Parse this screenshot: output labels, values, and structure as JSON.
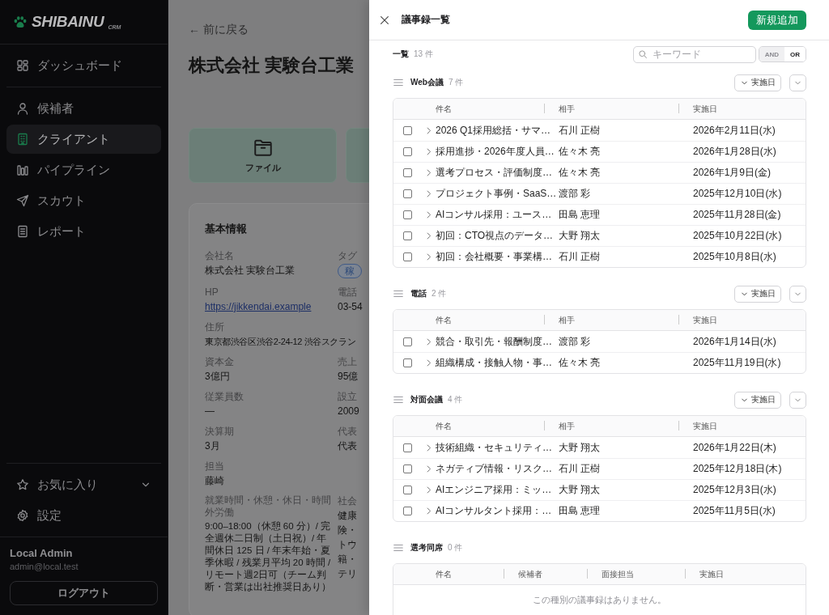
{
  "sidebar": {
    "logo": {
      "name": "SHIBAINU",
      "suffix": "CRM"
    },
    "nav_top": [
      {
        "label": "ダッシュボード",
        "selected": false
      }
    ],
    "nav": [
      {
        "label": "候補者",
        "selected": false
      },
      {
        "label": "クライアント",
        "selected": true
      },
      {
        "label": "パイプライン",
        "selected": false
      },
      {
        "label": "スカウト",
        "selected": false
      },
      {
        "label": "レポート",
        "selected": false
      }
    ],
    "favorites": {
      "label": "お気に入り"
    },
    "settings": {
      "label": "設定"
    },
    "user": {
      "name": "Local Admin",
      "email": "admin@local.test"
    },
    "logout_button": "ログアウト"
  },
  "page": {
    "back_link": "← 前に戻る",
    "title": "株式会社 実験台工業",
    "quick_actions": [
      {
        "label": "ファイル"
      }
    ],
    "basic_info": {
      "title": "基本情報",
      "rows": [
        [
          {
            "label": "会社名",
            "value": "株式会社 実験台工業"
          },
          {
            "label": "タグ",
            "kind": "tag",
            "value": "稼"
          }
        ],
        [
          {
            "label": "HP",
            "kind": "link",
            "value": "https://jikkendai.example"
          },
          {
            "label": "電話",
            "value": "03-54"
          }
        ],
        [
          {
            "label": "住所",
            "value": "東京都渋谷区渋谷2-24-12 渋谷スクラン"
          }
        ],
        [
          {
            "label": "資本金",
            "value": "3億円"
          },
          {
            "label": "売上",
            "value": "95億"
          }
        ],
        [
          {
            "label": "従業員数",
            "value": "—"
          },
          {
            "label": "設立",
            "value": "2009"
          }
        ],
        [
          {
            "label": "決算期",
            "value": "3月"
          },
          {
            "label": "代表",
            "value": "代表"
          }
        ],
        [
          {
            "label": "担当",
            "value": "藤崎"
          }
        ],
        [
          {
            "label": "就業時間・休憩・休日・時間外労働",
            "value": "9:00–18:00（休憩 60 分）/ 完全週休二日制（土日祝）/ 年間休日 125 日 / 年末年始・夏季休暇 / 残業月平均 20 時間 / リモート週2日可（チーム判断・営業は出社推奨日あり）"
          },
          {
            "label": "社会",
            "kind": "lines",
            "lines": [
              "健康",
              "険・",
              "トウ",
              "籍・",
              "テリ"
            ]
          }
        ]
      ]
    }
  },
  "drawer": {
    "title": "議事録一覧",
    "add_button": "新規追加",
    "list_label": "一覧",
    "list_count": "13 件",
    "search": {
      "placeholder": "キーワード"
    },
    "match_modes": [
      {
        "label": "AND",
        "selected": false
      },
      {
        "label": "OR",
        "selected": true
      }
    ],
    "sections": [
      {
        "title": "Web会議",
        "count": "7 件",
        "sort_label": "実施日",
        "columns": [
          "件名",
          "相手",
          "実施日"
        ],
        "rows": [
          {
            "checked": false,
            "cells": [
              "2026 Q1採用総括・サマ…",
              "石川 正樹",
              "2026年2月11日(水)"
            ]
          },
          {
            "checked": false,
            "cells": [
              "採用進捗・2026年度人員…",
              "佐々木 亮",
              "2026年1月28日(水)"
            ]
          },
          {
            "checked": false,
            "cells": [
              "選考プロセス・評価制度…",
              "佐々木 亮",
              "2026年1月9日(金)"
            ]
          },
          {
            "checked": false,
            "cells": [
              "プロジェクト事例・SaaS…",
              "渡部 彩",
              "2025年12月10日(水)"
            ]
          },
          {
            "checked": false,
            "cells": [
              "AIコンサル採用：ユース…",
              "田島 恵理",
              "2025年11月28日(金)"
            ]
          },
          {
            "checked": false,
            "cells": [
              "初回：CTO視点のデータ…",
              "大野 翔太",
              "2025年10月22日(水)"
            ]
          },
          {
            "checked": false,
            "cells": [
              "初回：会社概要・事業構…",
              "石川 正樹",
              "2025年10月8日(水)"
            ]
          }
        ]
      },
      {
        "title": "電話",
        "count": "2 件",
        "sort_label": "実施日",
        "columns": [
          "件名",
          "相手",
          "実施日"
        ],
        "rows": [
          {
            "checked": false,
            "cells": [
              "競合・取引先・報酬制度…",
              "渡部 彩",
              "2026年1月14日(水)"
            ]
          },
          {
            "checked": false,
            "cells": [
              "組織構成・接触人物・事…",
              "佐々木 亮",
              "2025年11月19日(水)"
            ]
          }
        ]
      },
      {
        "title": "対面会議",
        "count": "4 件",
        "sort_label": "実施日",
        "columns": [
          "件名",
          "相手",
          "実施日"
        ],
        "rows": [
          {
            "checked": false,
            "cells": [
              "技術組織・セキュリティ…",
              "大野 翔太",
              "2026年1月22日(木)"
            ]
          },
          {
            "checked": false,
            "cells": [
              "ネガティブ情報・リスク…",
              "石川 正樹",
              "2025年12月18日(木)"
            ]
          },
          {
            "checked": false,
            "cells": [
              "AIエンジニア採用：ミッ…",
              "大野 翔太",
              "2025年12月3日(水)"
            ]
          },
          {
            "checked": false,
            "cells": [
              "AIコンサルタント採用：…",
              "田島 恵理",
              "2025年11月5日(水)"
            ]
          }
        ]
      },
      {
        "title": "選考同席",
        "count": "0 件",
        "columns": [
          "件名",
          "候補者",
          "面接担当",
          "実施日"
        ],
        "empty_message": "この種別の議事録はありません。"
      }
    ]
  }
}
